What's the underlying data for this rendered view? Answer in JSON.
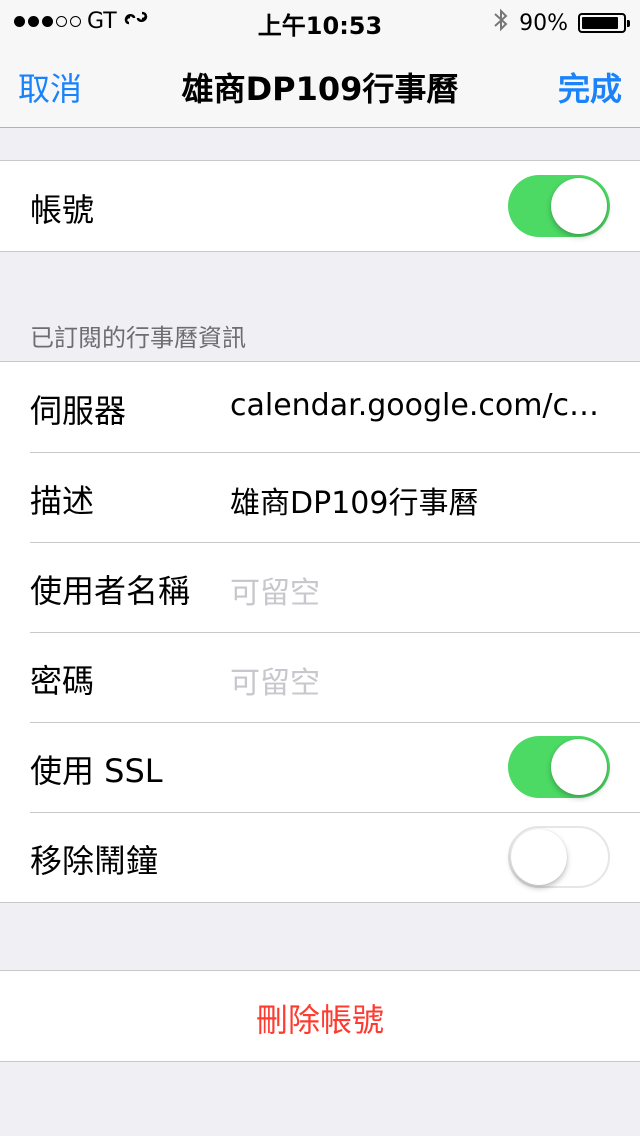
{
  "status_bar": {
    "carrier": "GT",
    "time": "上午10:53",
    "battery_percent": "90%",
    "battery_level": 0.9,
    "signal_bars_filled": 3,
    "signal_bars_total": 5
  },
  "nav": {
    "cancel_label": "取消",
    "title": "雄商DP109行事曆",
    "done_label": "完成"
  },
  "account": {
    "label": "帳號",
    "enabled": true
  },
  "subscribed_section": {
    "header": "已訂閱的行事曆資訊",
    "server": {
      "label": "伺服器",
      "value": "calendar.google.com/calen…"
    },
    "description": {
      "label": "描述",
      "value": "雄商DP109行事曆"
    },
    "username": {
      "label": "使用者名稱",
      "placeholder": "可留空"
    },
    "password": {
      "label": "密碼",
      "placeholder": "可留空"
    },
    "use_ssl": {
      "label": "使用 SSL",
      "enabled": true
    },
    "remove_alarms": {
      "label": "移除鬧鐘",
      "enabled": false
    }
  },
  "delete_account_label": "刪除帳號",
  "colors": {
    "accent": "#1a82fb",
    "toggle_on": "#4cd964",
    "destructive": "#ff3b30"
  }
}
